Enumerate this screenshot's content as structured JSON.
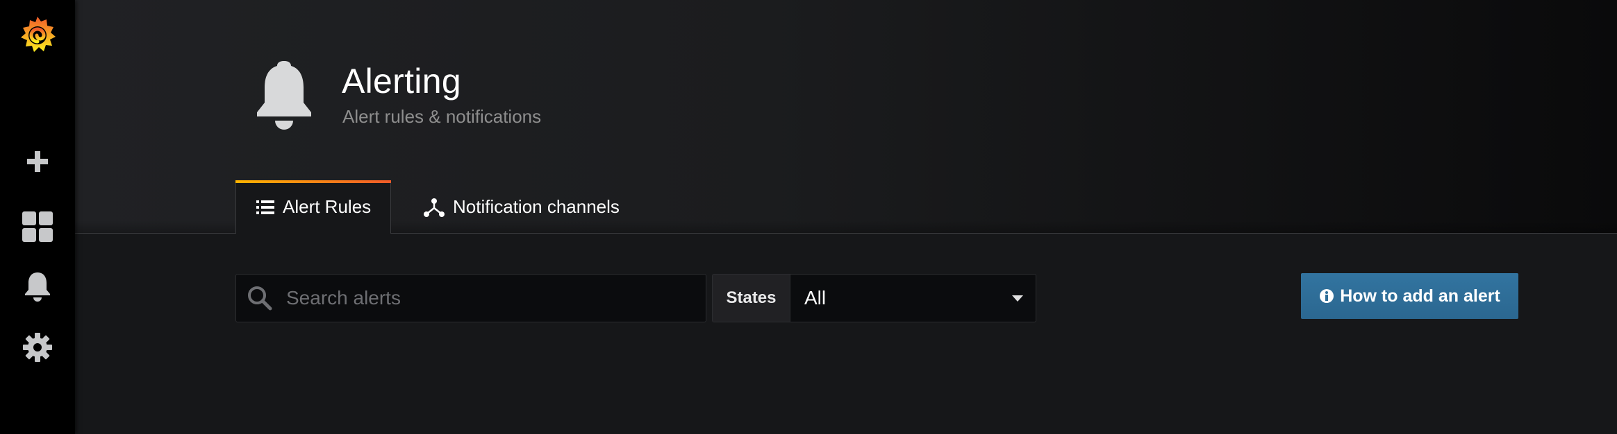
{
  "sidebar": {
    "logo": "grafana-logo",
    "items": [
      {
        "name": "create",
        "icon": "plus-icon"
      },
      {
        "name": "dashboards",
        "icon": "dashboard-grid-icon"
      },
      {
        "name": "alerting",
        "icon": "bell-icon"
      },
      {
        "name": "configuration",
        "icon": "gear-icon"
      }
    ]
  },
  "header": {
    "icon": "bell-icon",
    "title": "Alerting",
    "subtitle": "Alert rules & notifications"
  },
  "tabs": [
    {
      "label": "Alert Rules",
      "icon": "list-icon",
      "active": true
    },
    {
      "label": "Notification channels",
      "icon": "share-nodes-icon",
      "active": false
    }
  ],
  "toolbar": {
    "search_placeholder": "Search alerts",
    "search_value": "",
    "states_label": "States",
    "states_selected": "All",
    "help_button_label": "How to add an alert"
  },
  "colors": {
    "accent_gradient_start": "#ffb300",
    "accent_gradient_end": "#f05a28",
    "primary_button": "#3274a0",
    "background": "#161719",
    "sidebar": "#000000"
  }
}
